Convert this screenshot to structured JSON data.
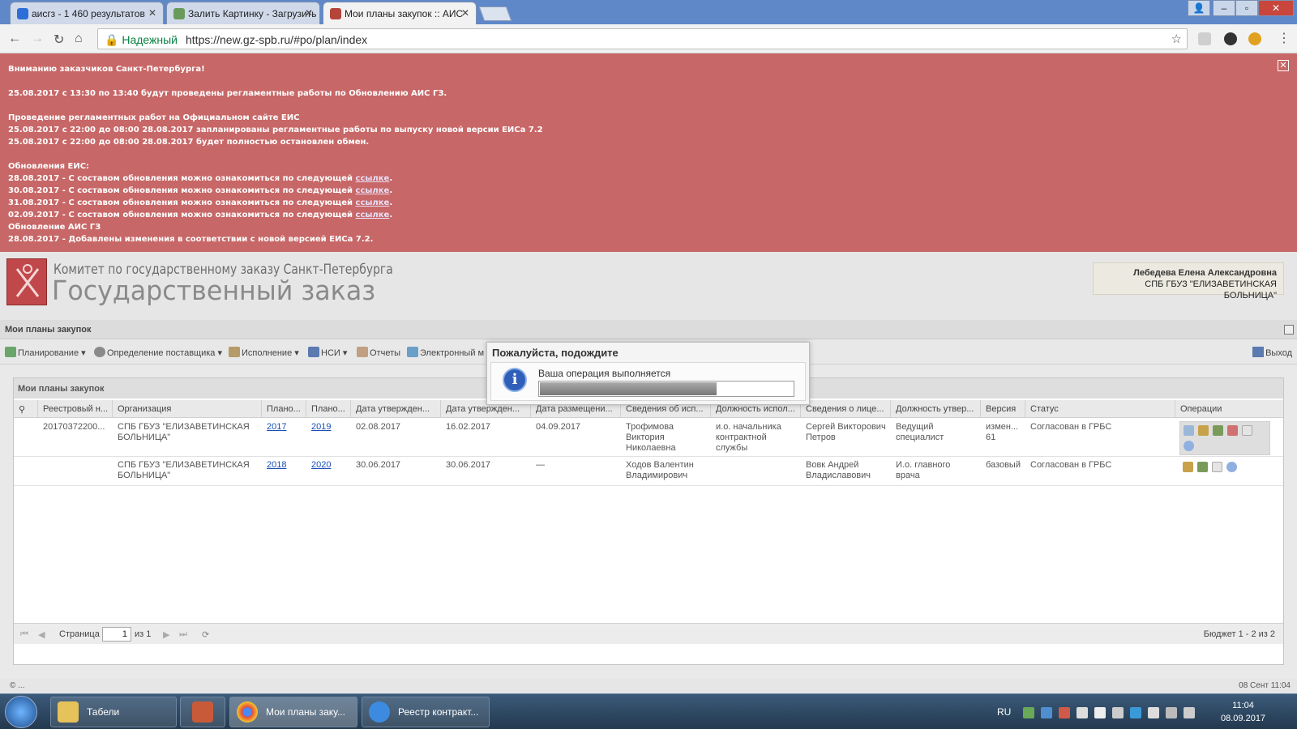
{
  "browser": {
    "tabs": [
      {
        "label": "аисгз - 1 460 результатов",
        "icon": "search-icon",
        "active": false
      },
      {
        "label": "Залить Картинку - Загрузить",
        "icon": "image-icon",
        "active": false
      },
      {
        "label": "Мои планы закупок :: АИС",
        "icon": "gavel-icon",
        "active": true
      }
    ],
    "secure_label": "Надежный",
    "url": "https://new.gz-spb.ru/#po/plan/index"
  },
  "banner": {
    "lines": [
      "Вниманию заказчиков Санкт-Петербурга!",
      "",
      "25.08.2017 с 13:30 по 13:40 будут проведены регламентные работы по Обновлению АИС ГЗ.",
      "",
      "Проведение регламентных работ на Официальном сайте ЕИС",
      "25.08.2017 с 22:00 до 08:00 28.08.2017 запланированы регламентные работы по выпуску новой версии ЕИСа 7.2",
      "25.08.2017 с 22:00 до 08:00 28.08.2017 будет полностью остановлен обмен.",
      "",
      "Обновления ЕИС:"
    ],
    "updates": [
      {
        "text": "28.08.2017 - С составом обновления можно ознакомиться по следующей ",
        "link": "ссылке"
      },
      {
        "text": "30.08.2017 - С составом обновления можно ознакомиться по следующей ",
        "link": "ссылке"
      },
      {
        "text": "31.08.2017 - С составом обновления можно ознакомиться по следующей ",
        "link": "ссылке"
      },
      {
        "text": "02.09.2017 - С составом обновления можно ознакомиться по следующей ",
        "link": "ссылке"
      }
    ],
    "tail": [
      " Обновление АИС ГЗ",
      "28.08.2017 - Добавлены изменения в соответствии с новой версией ЕИСа 7.2."
    ]
  },
  "header": {
    "org_line1": "Комитет по государственному заказу Санкт-Петербурга",
    "org_line2": "Государственный заказ",
    "user_name": "Лебедева Елена Александровна",
    "user_org": "СПБ ГБУЗ \"ЕЛИЗАВЕТИНСКАЯ БОЛЬНИЦА\""
  },
  "panel": {
    "title": "Мои планы закупок",
    "toolbar": [
      "Планирование",
      "Определение поставщика",
      "Исполнение",
      "НСИ",
      "Отчеты",
      "Электронный м"
    ],
    "exit_label": "Выход"
  },
  "grid": {
    "title": "Мои планы закупок",
    "columns": [
      "Реестровый н...",
      "Организация",
      "Плано...",
      "Плано...",
      "Дата утвержден...",
      "Дата утвержден...",
      "Дата размещени...",
      "Сведения об исп...",
      "Должность испол...",
      "Сведения о лице...",
      "Должность утвер...",
      "Версия",
      "Статус",
      "Операции"
    ],
    "rows": [
      [
        "20170372200...",
        "СПБ ГБУЗ \"ЕЛИЗАВЕТИНСКАЯ БОЛЬНИЦА\"",
        "2017",
        "2019",
        "02.08.2017",
        "16.02.2017",
        "04.09.2017",
        "Трофимова Виктория Николаевна",
        "и.о. начальника контрактной службы",
        "Сергей Викторович Петров",
        "Ведущий специалист",
        "измен... 61",
        "Согласован в ГРБС"
      ],
      [
        "",
        "СПБ ГБУЗ \"ЕЛИЗАВЕТИНСКАЯ БОЛЬНИЦА\"",
        "2018",
        "2020",
        "30.06.2017",
        "30.06.2017",
        "—",
        "Ходов Валентин Владимирович",
        "",
        "Вовк Андрей Владиславович",
        "И.о. главного врача",
        "базовый",
        "Согласован в ГРБС"
      ]
    ],
    "pager": {
      "page_label": "Страница",
      "page_value": "1",
      "of_label": "из 1",
      "summary": "Бюджет 1 - 2 из 2"
    }
  },
  "footer": {
    "left": "© ...",
    "right": "08 Сент 11:04"
  },
  "modal": {
    "title": "Пожалуйста, подождите",
    "message": "Ваша операция выполняется",
    "progress": 0.7
  },
  "taskbar": {
    "items": [
      "Табели",
      "",
      "Мои планы заку...",
      "Реестр контракт..."
    ],
    "lang": "RU",
    "time": "11:04",
    "date": "08.09.2017"
  },
  "colors": {
    "banner": "#c86767",
    "link": "#1a4fb5",
    "accent": "#2f5fb8"
  }
}
